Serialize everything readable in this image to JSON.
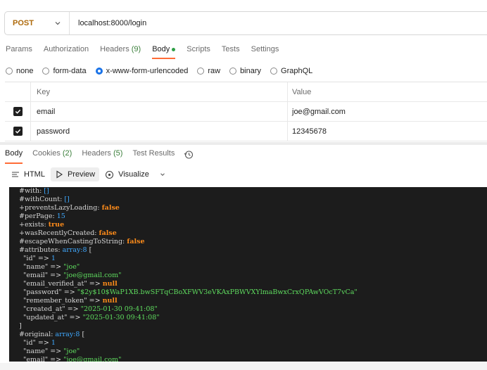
{
  "request": {
    "method": "POST",
    "url": "localhost:8000/login"
  },
  "request_tabs": [
    {
      "label": "Params",
      "count": ""
    },
    {
      "label": "Authorization",
      "count": ""
    },
    {
      "label": "Headers",
      "count": "(9)"
    },
    {
      "label": "Body",
      "count": ""
    },
    {
      "label": "Scripts",
      "count": ""
    },
    {
      "label": "Tests",
      "count": ""
    },
    {
      "label": "Settings",
      "count": ""
    }
  ],
  "active_request_tab": "Body",
  "body_types": [
    "none",
    "form-data",
    "x-www-form-urlencoded",
    "raw",
    "binary",
    "GraphQL"
  ],
  "selected_body_type": "x-www-form-urlencoded",
  "params_table": {
    "headers": {
      "key": "Key",
      "value": "Value"
    },
    "rows": [
      {
        "key": "email",
        "value": "joe@gmail.com",
        "checked": true
      },
      {
        "key": "password",
        "value": "12345678",
        "checked": true
      }
    ]
  },
  "response_tabs": [
    {
      "label": "Body",
      "count": ""
    },
    {
      "label": "Cookies",
      "count": "(2)"
    },
    {
      "label": "Headers",
      "count": "(5)"
    },
    {
      "label": "Test Results",
      "count": ""
    }
  ],
  "view_modes": [
    "HTML",
    "Preview",
    "Visualize"
  ],
  "active_view_mode": "Preview",
  "colors": {
    "accent": "#ff6c37",
    "method": "#ae6a0b",
    "radio": "#1a73e8"
  },
  "console_lines": [
    [
      [
        "k",
        "#with: "
      ],
      [
        "arr",
        "[]"
      ]
    ],
    [
      [
        "k",
        "#withCount: "
      ],
      [
        "arr",
        "[]"
      ]
    ],
    [
      [
        "k",
        "+preventsLazyLoading: "
      ],
      [
        "kw",
        "false"
      ]
    ],
    [
      [
        "k",
        "#perPage: "
      ],
      [
        "num",
        "15"
      ]
    ],
    [
      [
        "k",
        "+exists: "
      ],
      [
        "kw",
        "true"
      ]
    ],
    [
      [
        "k",
        "+wasRecentlyCreated: "
      ],
      [
        "kw",
        "false"
      ]
    ],
    [
      [
        "k",
        "#escapeWhenCastingToString: "
      ],
      [
        "kw",
        "false"
      ]
    ],
    [
      [
        "k",
        "#attributes: "
      ],
      [
        "arr",
        "array:8"
      ],
      [
        "k",
        " ["
      ]
    ],
    [
      [
        "k",
        "  \"id\" => "
      ],
      [
        "num",
        "1"
      ]
    ],
    [
      [
        "k",
        "  \"name\" => "
      ],
      [
        "str",
        "\"joe\""
      ]
    ],
    [
      [
        "k",
        "  \"email\" => "
      ],
      [
        "str",
        "\"joe@gmail.com\""
      ]
    ],
    [
      [
        "k",
        "  \"email_verified_at\" => "
      ],
      [
        "kw",
        "null"
      ]
    ],
    [
      [
        "k",
        "  \"password\" => "
      ],
      [
        "str",
        "\"$2y$10$WaP1XB.bwSFTqCBoXFWV3eVKAxPBWVXYlmaBwxCrxQPAwVOcT7vCa\""
      ]
    ],
    [
      [
        "k",
        "  \"remember_token\" => "
      ],
      [
        "kw",
        "null"
      ]
    ],
    [
      [
        "k",
        "  \"created_at\" => "
      ],
      [
        "str",
        "\"2025-01-30 09:41:08\""
      ]
    ],
    [
      [
        "k",
        "  \"updated_at\" => "
      ],
      [
        "str",
        "\"2025-01-30 09:41:08\""
      ]
    ],
    [
      [
        "k",
        "]"
      ]
    ],
    [
      [
        "k",
        "#original: "
      ],
      [
        "arr",
        "array:8"
      ],
      [
        "k",
        " ["
      ]
    ],
    [
      [
        "k",
        "  \"id\" => "
      ],
      [
        "num",
        "1"
      ]
    ],
    [
      [
        "k",
        "  \"name\" => "
      ],
      [
        "str",
        "\"joe\""
      ]
    ],
    [
      [
        "k",
        "  \"email\" => "
      ],
      [
        "str",
        "\"joe@gmail.com\""
      ]
    ]
  ]
}
